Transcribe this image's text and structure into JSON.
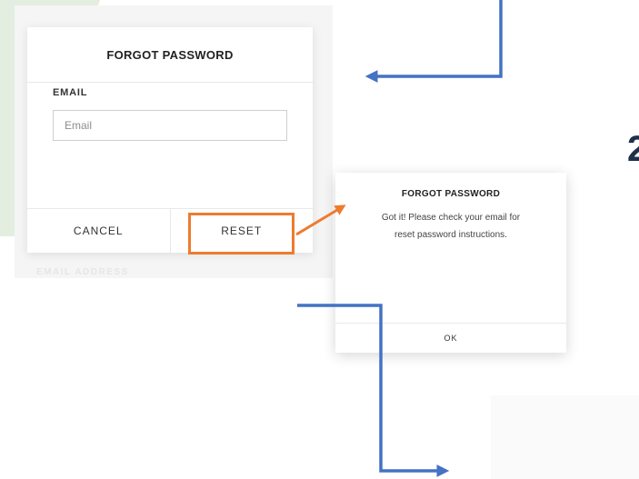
{
  "background": {
    "faded_label": "EMAIL ADDRESS",
    "side_number": "2"
  },
  "forgot_dialog": {
    "title": "FORGOT PASSWORD",
    "email_label": "EMAIL",
    "email_placeholder": "Email",
    "email_value": "",
    "cancel_label": "CANCEL",
    "reset_label": "RESET"
  },
  "confirm_dialog": {
    "title": "FORGOT PASSWORD",
    "message_line1": "Got it! Please check your email for",
    "message_line2": "reset password instructions.",
    "ok_label": "OK"
  },
  "colors": {
    "highlight": "#ee7b30",
    "arrow_blue": "#4472c4",
    "accent_green": "#e3eee0"
  },
  "icons": [
    "arrow-left-icon",
    "arrow-right-icon",
    "arrow-diagonal-icon"
  ]
}
